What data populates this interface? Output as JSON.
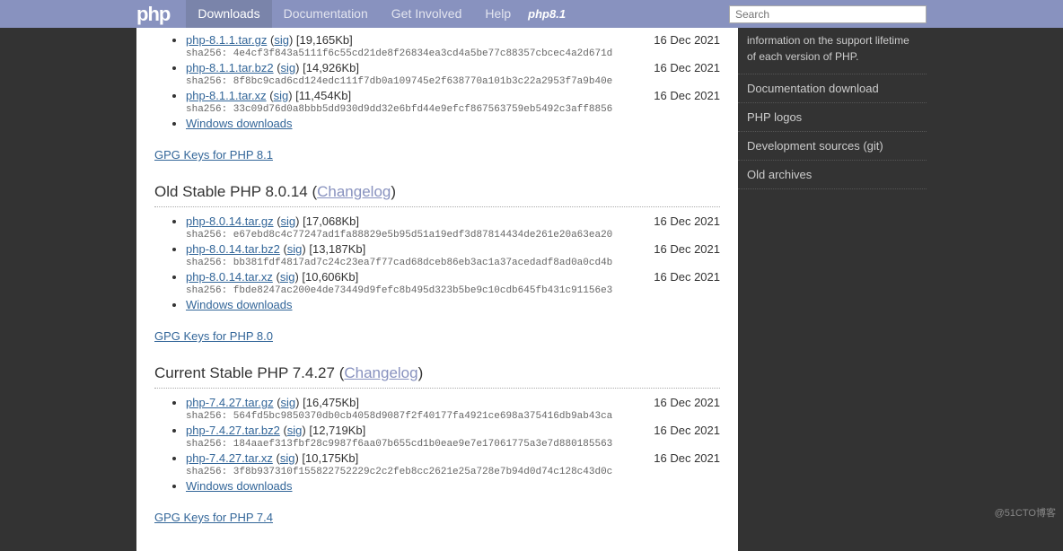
{
  "header": {
    "logo": "php",
    "nav": [
      "Downloads",
      "Documentation",
      "Get Involved",
      "Help"
    ],
    "php8": "php8.1",
    "search_placeholder": "Search"
  },
  "sidebar": {
    "intro": "information on the support lifetime of each version of PHP.",
    "links": [
      "Documentation download",
      "PHP logos",
      "Development sources (git)",
      "Old archives"
    ]
  },
  "sections": [
    {
      "id": "php81",
      "gpg": "GPG Keys for PHP 8.1",
      "files": [
        {
          "name": "php-8.1.1.tar.gz",
          "sig": "sig",
          "size": "[19,165Kb]",
          "date": "16 Dec 2021",
          "sha": "sha256: 4e4cf3f843a5111f6c55cd21de8f26834ea3cd4a5be77c88357cbcec4a2d671d"
        },
        {
          "name": "php-8.1.1.tar.bz2",
          "sig": "sig",
          "size": "[14,926Kb]",
          "date": "16 Dec 2021",
          "sha": "sha256: 8f8bc9cad6cd124edc111f7db0a109745e2f638770a101b3c22a2953f7a9b40e"
        },
        {
          "name": "php-8.1.1.tar.xz",
          "sig": "sig",
          "size": "[11,454Kb]",
          "date": "16 Dec 2021",
          "sha": "sha256: 33c09d76d0a8bbb5dd930d9dd32e6bfd44e9efcf867563759eb5492c3aff8856"
        }
      ],
      "win": "Windows downloads"
    },
    {
      "id": "php80",
      "title_pre": "Old Stable PHP 8.0.14 (",
      "title_link": "Changelog",
      "title_post": ")",
      "gpg": "GPG Keys for PHP 8.0",
      "files": [
        {
          "name": "php-8.0.14.tar.gz",
          "sig": "sig",
          "size": "[17,068Kb]",
          "date": "16 Dec 2021",
          "sha": "sha256: e67ebd8c4c77247ad1fa88829e5b95d51a19edf3d87814434de261e20a63ea20"
        },
        {
          "name": "php-8.0.14.tar.bz2",
          "sig": "sig",
          "size": "[13,187Kb]",
          "date": "16 Dec 2021",
          "sha": "sha256: bb381fdf4817ad7c24c23ea7f77cad68dceb86eb3ac1a37acedadf8ad0a0cd4b"
        },
        {
          "name": "php-8.0.14.tar.xz",
          "sig": "sig",
          "size": "[10,606Kb]",
          "date": "16 Dec 2021",
          "sha": "sha256: fbde8247ac200e4de73449d9fefc8b495d323b5be9c10cdb645fb431c91156e3"
        }
      ],
      "win": "Windows downloads"
    },
    {
      "id": "php74",
      "title_pre": "Current Stable PHP 7.4.27 (",
      "title_link": "Changelog",
      "title_post": ")",
      "gpg": "GPG Keys for PHP 7.4",
      "files": [
        {
          "name": "php-7.4.27.tar.gz",
          "sig": "sig",
          "size": "[16,475Kb]",
          "date": "16 Dec 2021",
          "sha": "sha256: 564fd5bc9850370db0cb4058d9087f2f40177fa4921ce698a375416db9ab43ca"
        },
        {
          "name": "php-7.4.27.tar.bz2",
          "sig": "sig",
          "size": "[12,719Kb]",
          "date": "16 Dec 2021",
          "sha": "sha256: 184aaef313fbf28c9987f6aa07b655cd1b0eae9e7e17061775a3e7d880185563"
        },
        {
          "name": "php-7.4.27.tar.xz",
          "sig": "sig",
          "size": "[10,175Kb]",
          "date": "16 Dec 2021",
          "sha": "sha256: 3f8b937310f155822752229c2c2feb8cc2621e25a728e7b94d0d74c128c43d0c"
        }
      ],
      "win": "Windows downloads"
    }
  ],
  "watermark": "@51CTO博客"
}
